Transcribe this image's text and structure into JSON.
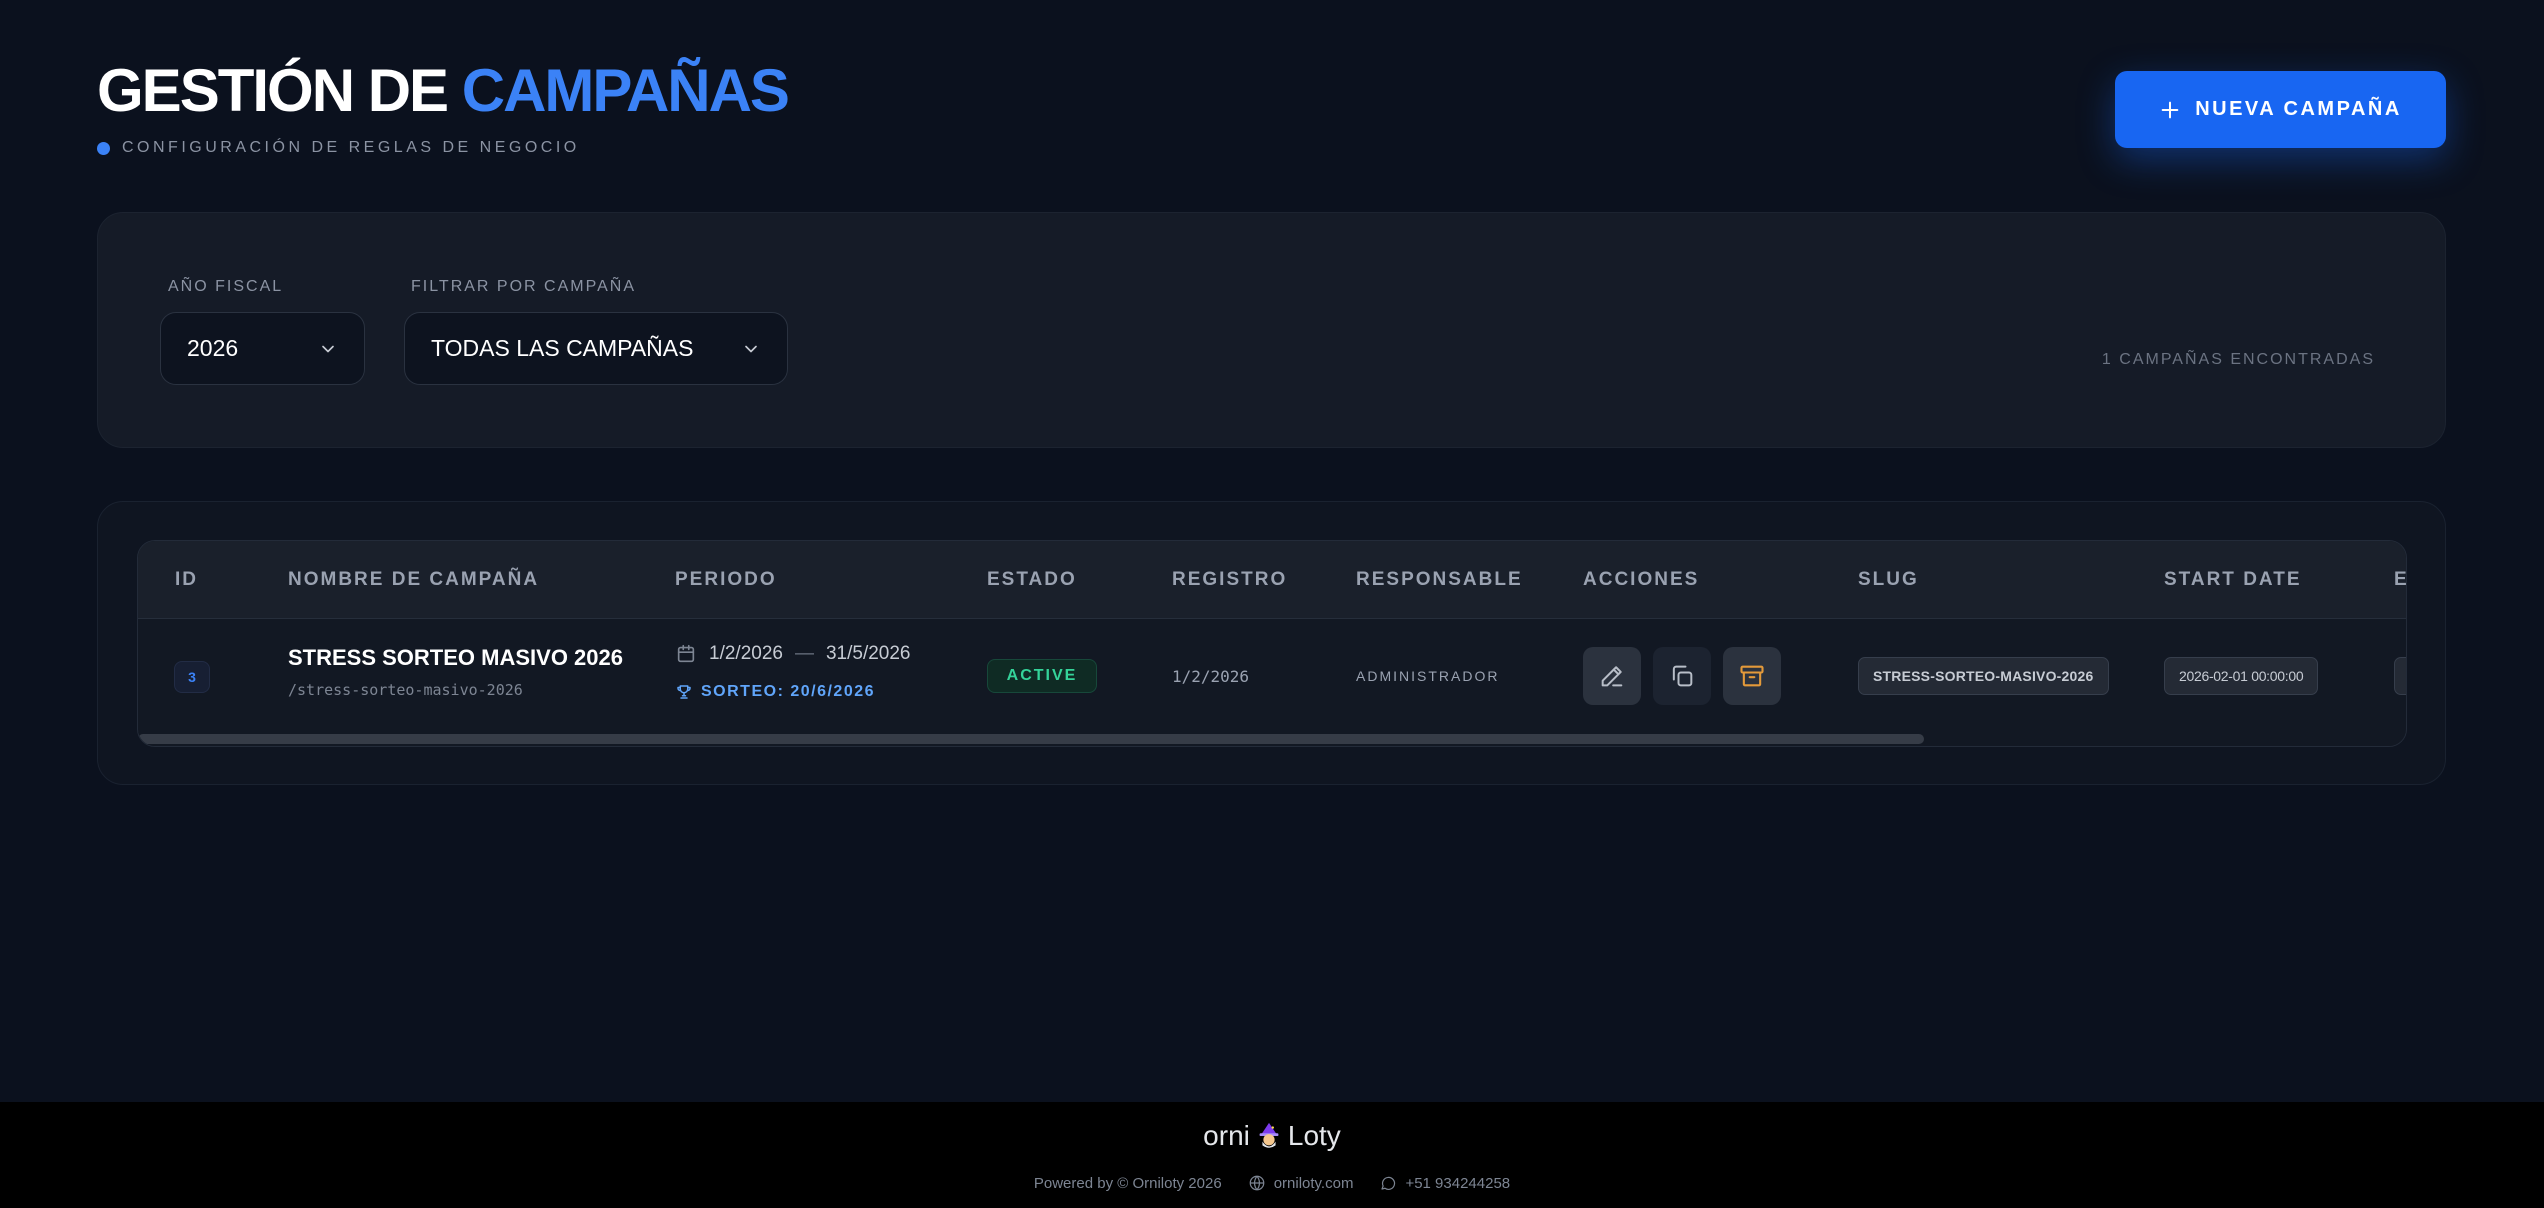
{
  "header": {
    "title_main": "GESTIÓN DE",
    "title_accent": "CAMPAÑAS",
    "subtitle": "CONFIGURACIÓN DE REGLAS DE NEGOCIO",
    "new_button": "NUEVA CAMPAÑA"
  },
  "filters": {
    "year_label": "AÑO FISCAL",
    "year_value": "2026",
    "campaign_label": "FILTRAR POR CAMPAÑA",
    "campaign_value": "TODAS LAS CAMPAÑAS",
    "found_text": "1 CAMPAÑAS ENCONTRADAS"
  },
  "table": {
    "columns": [
      "ID",
      "NOMBRE DE CAMPAÑA",
      "PERIODO",
      "ESTADO",
      "REGISTRO",
      "RESPONSABLE",
      "ACCIONES",
      "SLUG",
      "START DATE",
      "E"
    ],
    "rows": [
      {
        "id": "3",
        "name": "STRESS SORTEO MASIVO 2026",
        "slug_path": "/stress-sorteo-masivo-2026",
        "period_start": "1/2/2026",
        "period_sep": "—",
        "period_end": "31/5/2026",
        "sorteo": "SORTEO: 20/6/2026",
        "status": "ACTIVE",
        "registro": "1/2/2026",
        "responsable": "ADMINISTRADOR",
        "slug": "STRESS-SORTEO-MASIVO-2026",
        "start_date": "2026-02-01 00:00:00"
      }
    ]
  },
  "footer": {
    "brand_left": "orni",
    "brand_right": "Loty",
    "powered": "Powered by © Orniloty 2026",
    "website": "orniloty.com",
    "phone": "+51 934244258"
  },
  "icons": {
    "new_button": "plus-icon",
    "select_arrow": "chevron-down-icon",
    "period": "calendar-icon",
    "sorteo": "trophy-icon",
    "edit": "pencil-icon",
    "copy": "copy-icon",
    "archive": "archive-icon",
    "website": "globe-icon",
    "phone": "chat-icon"
  },
  "colors": {
    "accent": "#3b82f6",
    "button": "#1866f2",
    "status_active": "#34d399",
    "archive_icon": "#e49a3a"
  }
}
